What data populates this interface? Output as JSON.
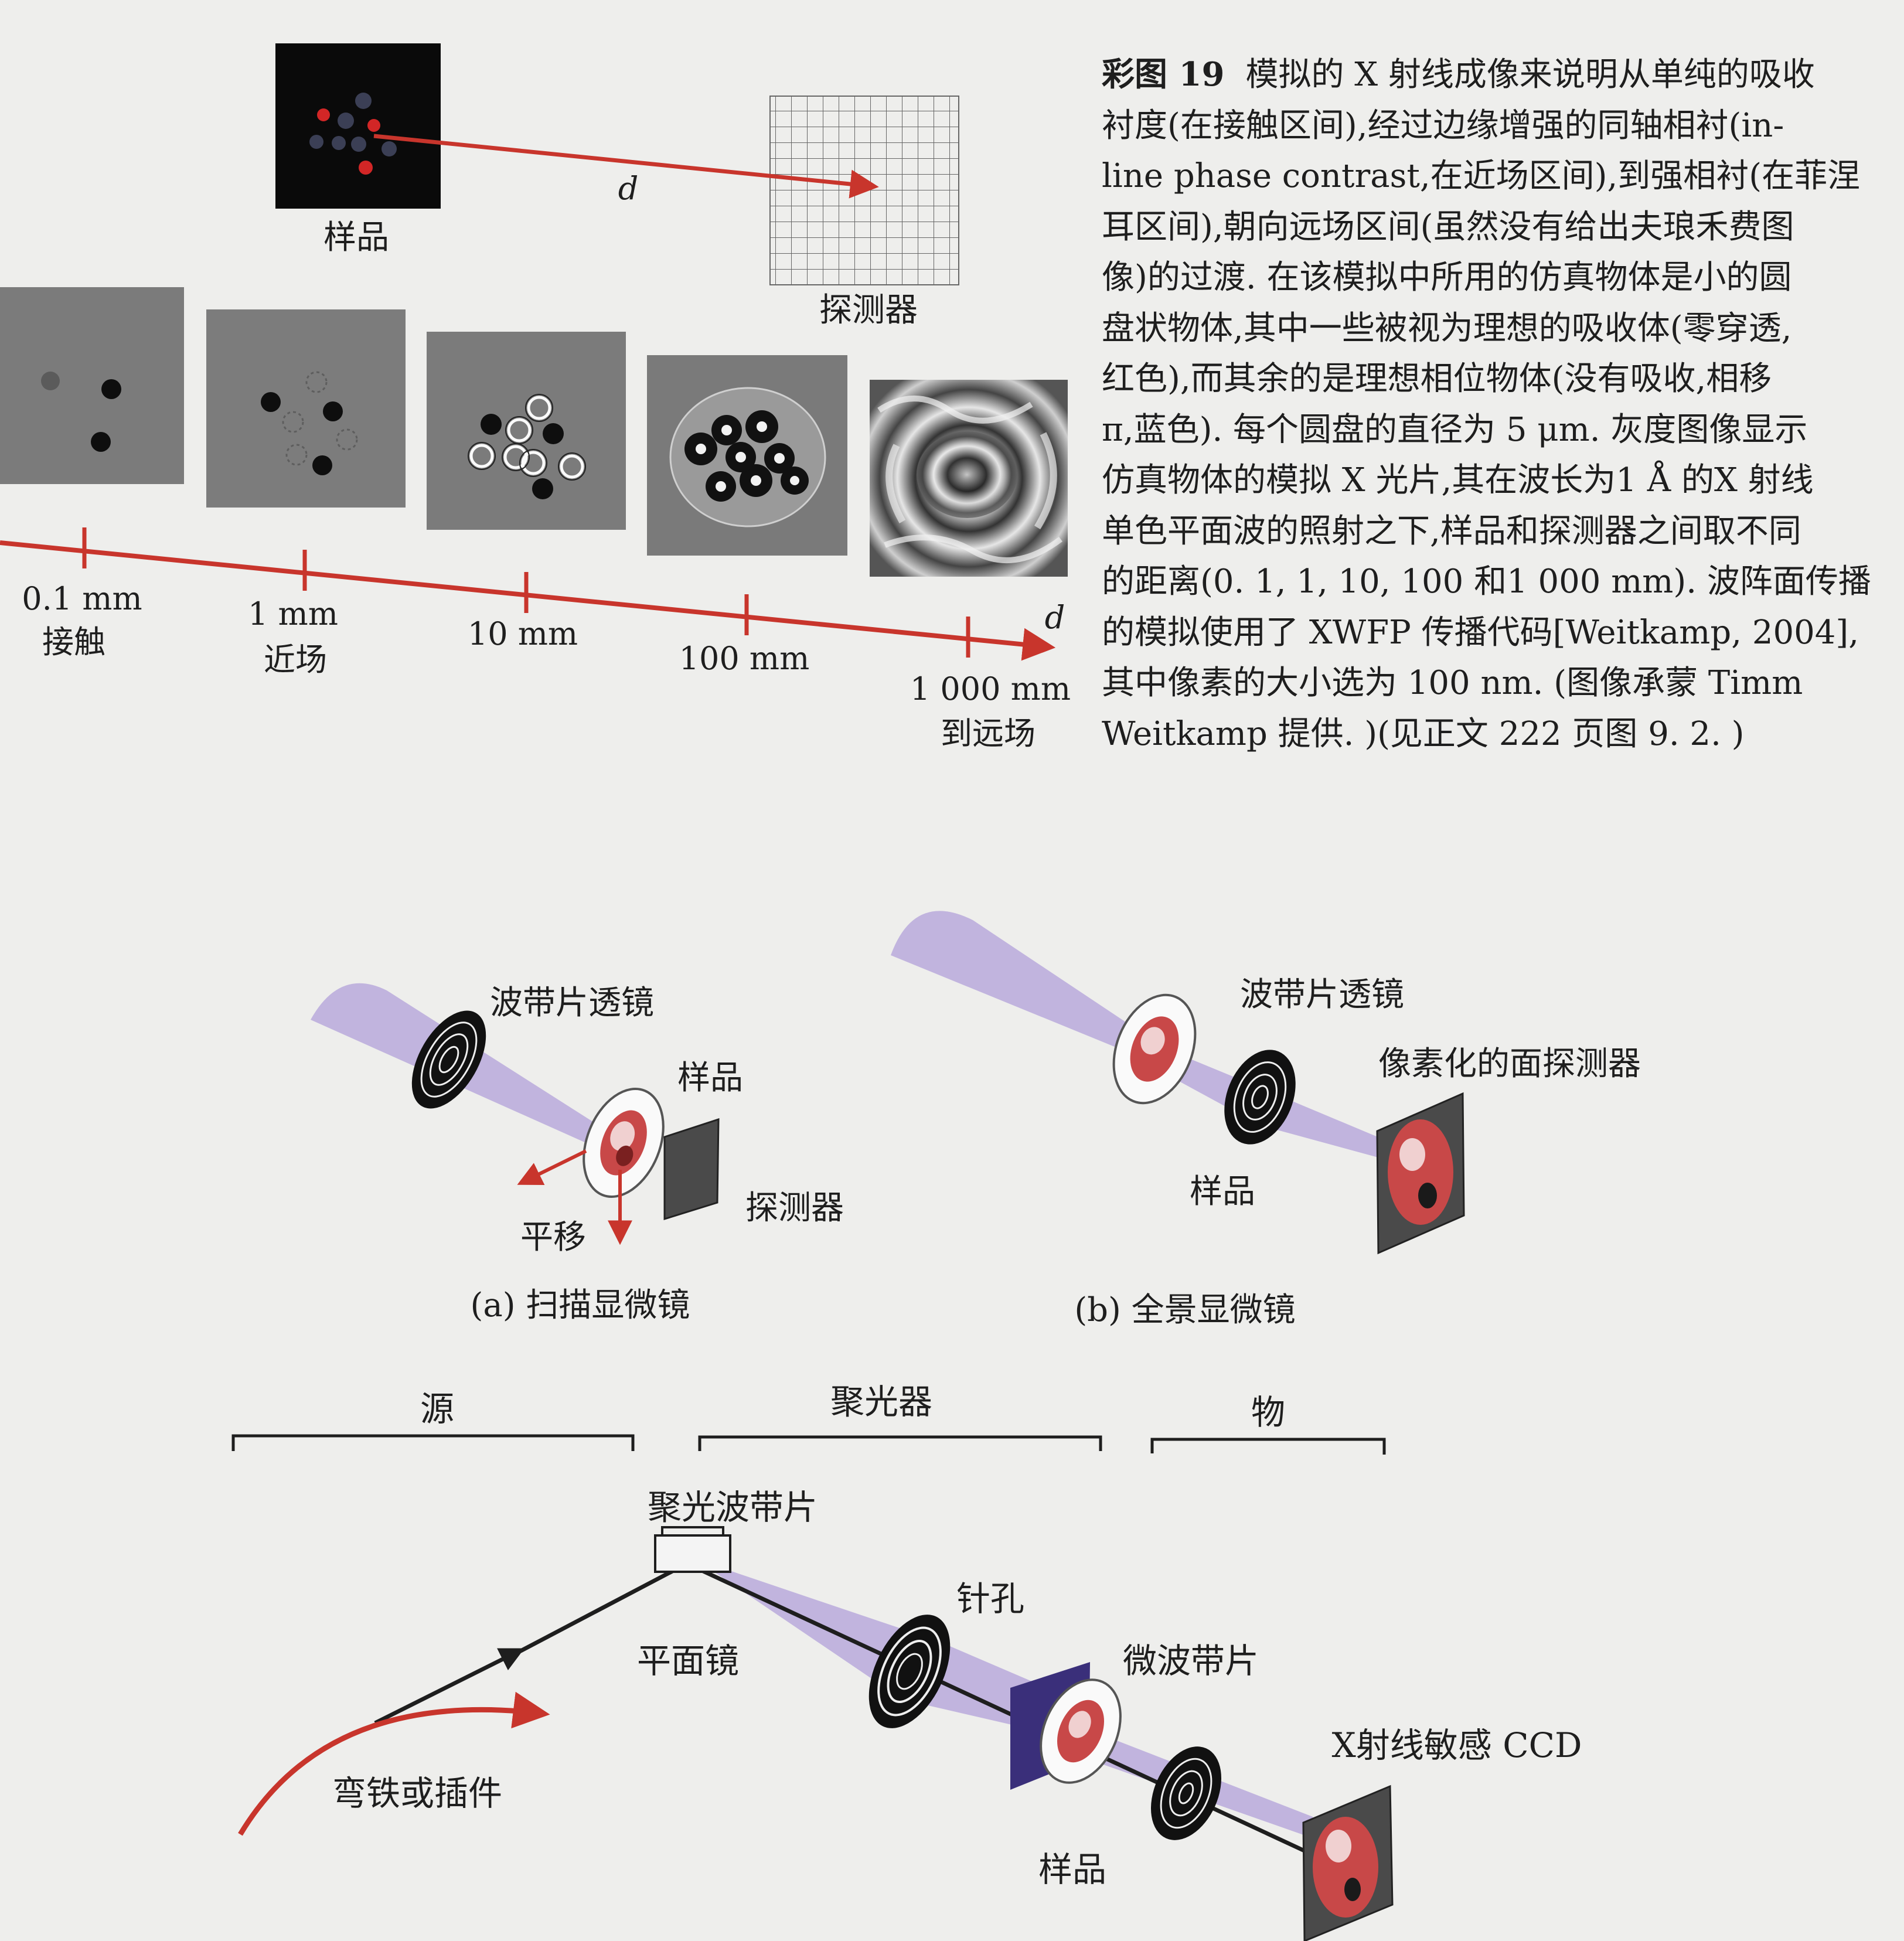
{
  "figure1": {
    "sample_label": "样品",
    "detector_label": "探测器",
    "distance_symbol": "d",
    "axis_ticks": [
      {
        "value": "0.1 mm",
        "regime": "接触"
      },
      {
        "value": "1 mm",
        "regime": "近场"
      },
      {
        "value": "10 mm",
        "regime": ""
      },
      {
        "value": "100 mm",
        "regime": ""
      },
      {
        "value": "1 000 mm",
        "regime": "到远场"
      }
    ]
  },
  "caption": {
    "label": "彩图 19",
    "lines": [
      "模拟的 X 射线成像来说明从单纯的吸收",
      "衬度(在接触区间),经过边缘增强的同轴相衬(in-",
      "line phase contrast,在近场区间),到强相衬(在菲涅",
      "耳区间),朝向远场区间(虽然没有给出夫琅禾费图",
      "像)的过渡. 在该模拟中所用的仿真物体是小的圆",
      "盘状物体,其中一些被视为理想的吸收体(零穿透,",
      "红色),而其余的是理想相位物体(没有吸收,相移",
      "π,蓝色). 每个圆盘的直径为 5 μm. 灰度图像显示",
      "仿真物体的模拟 X 光片,其在波长为1 Å 的X 射线",
      "单色平面波的照射之下,样品和探测器之间取不同",
      "的距离(0. 1, 1, 10, 100 和1 000 mm). 波阵面传播",
      "的模拟使用了 XWFP 传播代码[Weitkamp, 2004],",
      "其中像素的大小选为 100 nm. (图像承蒙 Timm",
      "Weitkamp 提供. )(见正文 222 页图 9. 2. )"
    ]
  },
  "figure2a": {
    "zone_plate": "波带片透镜",
    "sample": "样品",
    "detector": "探测器",
    "translate": "平移",
    "caption": "(a) 扫描显微镜"
  },
  "figure2b": {
    "zone_plate": "波带片透镜",
    "detector": "像素化的面探测器",
    "sample": "样品",
    "caption": "(b) 全景显微镜"
  },
  "figure3": {
    "source": "源",
    "condenser": "聚光器",
    "object": "物",
    "condenser_zone_plate": "聚光波带片",
    "pinhole": "针孔",
    "plane_mirror": "平面镜",
    "micro_zone_plate": "微波带片",
    "ccd": "X射线敏感 CCD",
    "bending_magnet": "弯铁或插件",
    "sample": "样品"
  },
  "colors": {
    "beam": "#b8a9dc",
    "arrow_red": "#c8352c",
    "panel_gray": "#808080",
    "ink": "#1e1e1e"
  }
}
